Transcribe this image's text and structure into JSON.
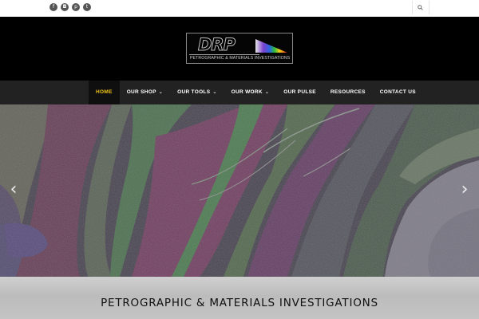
{
  "social": [
    {
      "icon": "facebook-icon",
      "glyph": "f"
    },
    {
      "icon": "instagram-icon",
      "glyph": "◘"
    },
    {
      "icon": "pinterest-icon",
      "glyph": "p"
    },
    {
      "icon": "twitter-icon",
      "glyph": "t"
    }
  ],
  "logo": {
    "mark": "DRP",
    "tagline": "PETROGRAPHIC & MATERIALS INVESTIGATIONS"
  },
  "nav": {
    "items": [
      {
        "label": "HOME",
        "active": true,
        "dropdown": false
      },
      {
        "label": "OUR SHOP",
        "active": false,
        "dropdown": true
      },
      {
        "label": "OUR TOOLS",
        "active": false,
        "dropdown": true
      },
      {
        "label": "OUR WORK",
        "active": false,
        "dropdown": true
      },
      {
        "label": "OUR PULSE",
        "active": false,
        "dropdown": false
      },
      {
        "label": "RESOURCES",
        "active": false,
        "dropdown": false
      },
      {
        "label": "CONTACT US",
        "active": false,
        "dropdown": false
      }
    ],
    "accent": "#f0c419"
  },
  "slider": {
    "prev_glyph": "‹",
    "next_glyph": "›"
  },
  "banner": {
    "title": "PETROGRAPHIC & MATERIALS INVESTIGATIONS"
  }
}
